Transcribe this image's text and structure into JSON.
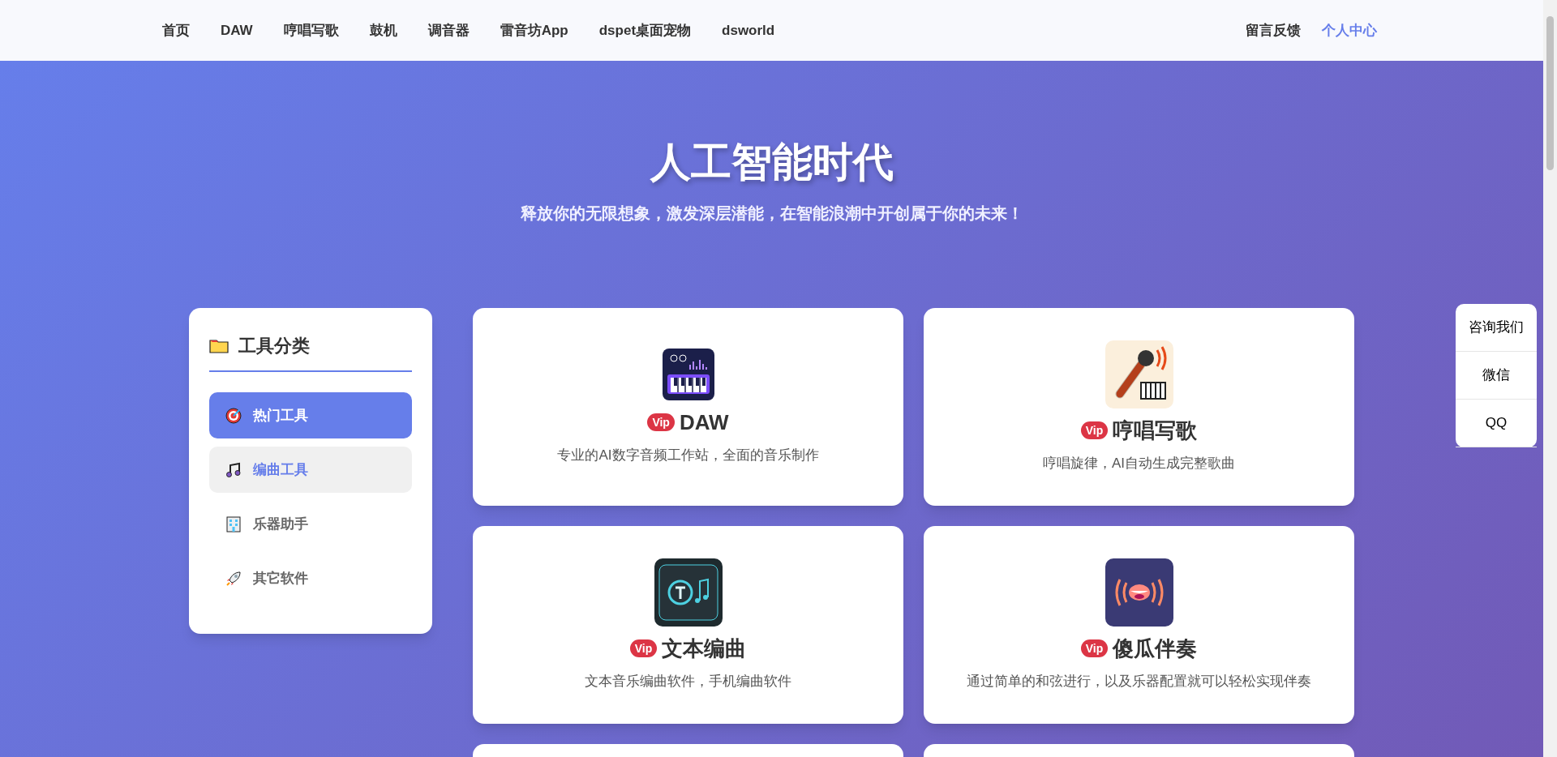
{
  "nav": {
    "left": [
      {
        "label": "首页",
        "selected": false
      },
      {
        "label": "DAW",
        "selected": false
      },
      {
        "label": "哼唱写歌",
        "selected": false
      },
      {
        "label": "鼓机",
        "selected": false
      },
      {
        "label": "调音器",
        "selected": false
      },
      {
        "label": "雷音坊App",
        "selected": false
      },
      {
        "label": "dspet桌面宠物",
        "selected": false
      },
      {
        "label": "dsworld",
        "selected": false
      }
    ],
    "right": [
      {
        "label": "留言反馈",
        "selected": false
      },
      {
        "label": "个人中心",
        "selected": true
      }
    ]
  },
  "hero": {
    "title": "人工智能时代",
    "subtitle": "释放你的无限想象，激发深层潜能，在智能浪潮中开创属于你的未来！"
  },
  "sidebar": {
    "title": "工具分类",
    "items": [
      {
        "label": "热门工具",
        "kind": "target",
        "selected": true,
        "highlighted": false
      },
      {
        "label": "编曲工具",
        "kind": "note",
        "selected": false,
        "highlighted": true
      },
      {
        "label": "乐器助手",
        "kind": "building",
        "selected": false,
        "highlighted": false
      },
      {
        "label": "其它软件",
        "kind": "rocket",
        "selected": false,
        "highlighted": false
      }
    ]
  },
  "tools": [
    {
      "badge": "Vip",
      "name": "DAW",
      "description": "专业的AI数字音频工作站，全面的音乐制作",
      "kind": "keyboard"
    },
    {
      "badge": "Vip",
      "name": "哼唱写歌",
      "description": "哼唱旋律，AI自动生成完整歌曲",
      "kind": "microphone"
    },
    {
      "badge": "Vip",
      "name": "文本编曲",
      "description": "文本音乐编曲软件，手机编曲软件",
      "kind": "text-note"
    },
    {
      "badge": "Vip",
      "name": "傻瓜伴奏",
      "description": "通过简单的和弦进行，以及乐器配置就可以轻松实现伴奏",
      "kind": "mouth"
    }
  ],
  "contact": [
    "咨询我们",
    "微信",
    "QQ"
  ]
}
